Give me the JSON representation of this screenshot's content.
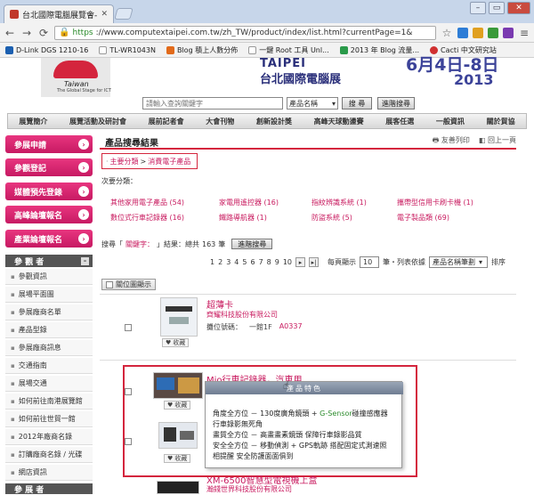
{
  "browser": {
    "tab_title": "台北國際電腦展覽會-產品...",
    "url_https": "https",
    "url_rest": "://www.computextaipei.com.tw/zh_TW/product/index/list.html?currentPage=1&",
    "bookmarks": [
      {
        "label": "D-Link DGS 1210-16",
        "icon": "dlink-icon"
      },
      {
        "label": "TL-WR1043N",
        "icon": "page-icon"
      },
      {
        "label": "Blog 積上人數分佈",
        "icon": "blog-icon"
      },
      {
        "label": "一鍵 Root 工具 Unl...",
        "icon": "page-icon"
      },
      {
        "label": "2013 年 Blog 流量...",
        "icon": "sheet-icon"
      },
      {
        "label": "Cacti 中文研究站",
        "icon": "cacti-icon"
      }
    ],
    "colors": {
      "accent": "#d4253d",
      "pink": "#c8195e"
    }
  },
  "header": {
    "logo_text": "Taiwan",
    "logo_sub": "The Global Stage for ICT",
    "taipei": "TAIPEI",
    "cn_title": "台北國際電腦展",
    "date": "6月4日-8日",
    "year": "2013"
  },
  "search": {
    "placeholder": "請輸入查詢關鍵字",
    "select_value": "產品名稱",
    "search_btn": "搜 尋",
    "advanced_btn": "進階搜尋"
  },
  "main_menu": [
    "展覽簡介",
    "展覽活動及研討會",
    "展前記者會",
    "大會刊物",
    "創新設計獎",
    "高峰天球動盪賽",
    "展客任選",
    "一般資訊",
    "關於貿協"
  ],
  "sidebar": {
    "pink_buttons": [
      "參展申請",
      "參觀登記",
      "媒體預先登錄",
      "高峰論壇報名",
      "產業論壇報名"
    ],
    "visitor_header": "參 觀 者",
    "items": [
      "參觀資訊",
      "展場平面圖",
      "參展廠商名單",
      "產品型錄",
      "參展廠商訊息",
      "交通指南",
      "展場交通",
      "如何前往南港展覽館",
      "如何前往世貿一館",
      "2012年廠商名錄",
      "訂購廠商名錄 / 光碟",
      "網店資訊"
    ],
    "exhibitor_header": "參 展 者"
  },
  "content": {
    "title": "產品搜尋結果",
    "print_link": "友善列印",
    "back_link": "回上一頁",
    "breadcrumb_main": "主要分類",
    "breadcrumb_sep": ">",
    "breadcrumb_sub": "消費電子產品",
    "subcat_label": "次要分類：",
    "categories": [
      "其他家用電子產品 (54)",
      "家電用遙控器 (16)",
      "指紋辨識系統 (1)",
      "攜帶型信用卡刷卡機 (1)",
      "數位式行車記錄器 (16)",
      "鐵路導航器 (1)",
      "防盜系統 (5)",
      "電子製品類 (69)"
    ],
    "search_info_prefix": "搜尋「",
    "search_keyword": "關鍵字：",
    "search_info_mid": "」結果：總共",
    "search_count": "163",
    "search_info_suffix": "筆",
    "advanced_btn2": "進階搜尋",
    "pages": [
      "1",
      "2",
      "3",
      "4",
      "5",
      "6",
      "7",
      "8",
      "9",
      "10"
    ],
    "per_page_label": "每頁顯示",
    "per_page_value": "10",
    "sort_label": "筆・列表依據",
    "sort_value": "產品名稱筆劃",
    "order_label": "排序",
    "show_image_btn": "關位圖顯示",
    "products": [
      {
        "name": "超薄卡",
        "company": "齊耀科技股份有限公司",
        "booth_label": "攤位號碼：",
        "booth_area": "一館1F",
        "booth_code": "A0337",
        "fav": "收藏"
      },
      {
        "name": "Mio行車記錄器，汽車用",
        "company": "",
        "booth_label": "",
        "booth_area": "",
        "booth_code": "",
        "fav": "收藏"
      },
      {
        "name": "",
        "company": "",
        "booth_label": "",
        "booth_area": "",
        "booth_code": "",
        "fav": "收藏"
      },
      {
        "name": "XM-6500智慧型電視機上盒",
        "company": "瀚錢世界科技股份有限公司",
        "booth_label": "",
        "booth_area": "",
        "booth_code": "",
        "fav": ""
      }
    ],
    "popup": {
      "title": "產品特色",
      "line1a": "角度全方位 － 130度廣角鏡頭 + ",
      "line1b": "G-Sensor",
      "line1c": "碰撞感應器",
      "line2": "行車錄影無死角",
      "line3": "畫質全方位 － 高畫畫素鏡頭 保障行車錄影品質",
      "line4": "安全全方位 － 移動偵測 + GPS軌跡 搭配固定式測速照",
      "line5": "相提醒 安全防護面面俱到"
    }
  }
}
